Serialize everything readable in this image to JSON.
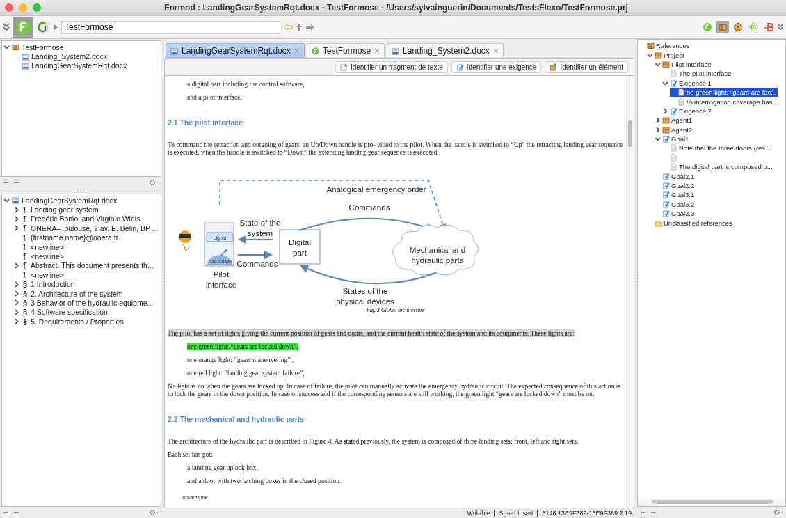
{
  "window": {
    "title": "Formod : LandingGearSystemRqt.docx - TestFormose - /Users/sylvainguerin/Documents/TestsFlexo/TestFormose.prj"
  },
  "toolbar": {
    "path_field": {
      "value": "TestFormose"
    }
  },
  "project_tree": [
    {
      "label": "TestFormose",
      "kind": "project",
      "expanded": true,
      "children": [
        {
          "label": "Landing_System2.docx",
          "kind": "docx"
        },
        {
          "label": "LandingGearSystemRqt.docx",
          "kind": "docx"
        }
      ]
    }
  ],
  "outline_tree": [
    {
      "label": "LandingGearSystemRqt.docx",
      "kind": "docx",
      "expanded": true,
      "children": [
        {
          "mark": "¶",
          "label": "Landing gear system",
          "kind": "paragraph",
          "expanded": false
        },
        {
          "mark": "¶",
          "label": "Frédéric Boniol and Virginie Wiels",
          "kind": "paragraph",
          "expanded": false
        },
        {
          "mark": "¶",
          "label": "ONERA–Toulouse, 2 av. E. Belin, BP ...",
          "kind": "paragraph",
          "expanded": false
        },
        {
          "mark": "¶",
          "label": "{firstname.name}@onera.fr",
          "kind": "paragraph"
        },
        {
          "mark": "¶",
          "label": "<newline>",
          "kind": "paragraph"
        },
        {
          "mark": "¶",
          "label": "<newline>",
          "kind": "paragraph"
        },
        {
          "mark": "¶",
          "label": "Abstract. This document presents th...",
          "kind": "paragraph",
          "expanded": false
        },
        {
          "mark": "¶",
          "label": "<newline>",
          "kind": "paragraph"
        },
        {
          "mark": "§",
          "label": "1 Introduction",
          "kind": "section",
          "expanded": false
        },
        {
          "mark": "§",
          "label": "2. Architecture of the system",
          "kind": "section",
          "expanded": false
        },
        {
          "mark": "§",
          "label": "3 Behavior of the hydraulic equipme...",
          "kind": "section",
          "expanded": false
        },
        {
          "mark": "§",
          "label": "4 Software specification",
          "kind": "section",
          "expanded": false
        },
        {
          "mark": "§",
          "label": "5. Requirements / Properties",
          "kind": "section",
          "expanded": false
        }
      ]
    }
  ],
  "tabs": [
    {
      "label": "LandingGearSystemRqt.docx",
      "kind": "docx",
      "selected": true
    },
    {
      "label": "TestFormose",
      "kind": "project-logo",
      "selected": false
    },
    {
      "label": "Landing_System2.docx",
      "kind": "docx",
      "selected": false
    }
  ],
  "action_buttons": [
    {
      "label": "Identifier un fragment de texte",
      "kind": "text"
    },
    {
      "label": "Identifier une exigence",
      "kind": "requirement"
    },
    {
      "label": "Identifier un élément",
      "kind": "element"
    }
  ],
  "document": [
    {
      "kind": "indent",
      "text": "a digital part including the control software,"
    },
    {
      "kind": "indent",
      "text": "and a pilot interface."
    },
    {
      "kind": "heading",
      "text": "2.1 The pilot interface"
    },
    {
      "kind": "para",
      "text": "To command the retraction and outgoing of gears, an Up/Down handle is pro- vided to the pilot. When the handle is switched to “Up” the retracting landing gear sequence is executed, when the handle is switched to “Down” the extending landing gear sequence is executed."
    },
    {
      "kind": "figure",
      "labels": {
        "emergency": [
          "Analogical emergency order"
        ],
        "commands_top": [
          "Commands"
        ],
        "state_system": [
          "State of the",
          "system"
        ],
        "lights": [
          "Lights"
        ],
        "up": [
          "Up"
        ],
        "down": [
          "Down"
        ],
        "commands_left": [
          "Commands"
        ],
        "digital": [
          "Digital",
          "part"
        ],
        "mechanical": [
          "Mechanical and",
          "hydraulic parts"
        ],
        "pilot": [
          "Pilot",
          "interface"
        ],
        "states_devices": [
          "States of the",
          "physical devices"
        ]
      },
      "caption": "**Fig. 3** Global architecture"
    },
    {
      "kind": "selection",
      "text": "The pilot has a set of lights giving the current position of gears and doors, and the current health state of the system and its equipments. These lights are:"
    },
    {
      "kind": "match",
      "text": "one green light: “gears are locked down”,"
    },
    {
      "kind": "indent",
      "text": "one orange light: “gears maneuvering” ,"
    },
    {
      "kind": "indent",
      "text": "one red light: “landing gear system failure”,"
    },
    {
      "kind": "para",
      "text": "No light is on when the gears are locked up. In case of failure, the pilot can manually activate the emergency hydraulic circuit. The expected consequence of this action is to lock the gears in the down position. In case of success and if the corresponding sensors are still working, the green light “gears are locked down” must be on."
    },
    {
      "kind": "heading",
      "text": "2.2 The mechanical and hydraulic parts"
    },
    {
      "kind": "para",
      "text": "The architecture of the hydraulic part is described in Figure 4. As stated previously, the system is composed of three landing sets: front, left and right sets."
    },
    {
      "kind": "para",
      "text": "Each set has got:"
    },
    {
      "kind": "indent",
      "text": "a landing gear uplock box,"
    },
    {
      "kind": "indent",
      "text": "and a door with two latching boxes in the closed position."
    },
    {
      "kind": "small",
      "text": "Towards the"
    }
  ],
  "status_bar": [
    "Writable",
    "Smart Insert",
    "3148  13E9F389-13E9F389:2:19"
  ],
  "references": [
    {
      "label": "References",
      "kind": "references",
      "selected": false,
      "children": [
        {
          "label": "Project",
          "kind": "package",
          "expanded": true,
          "selected": false,
          "children": [
            {
              "label": "Pilot interface",
              "kind": "package",
              "expanded": true,
              "selected": false,
              "children": [
                {
                  "label": "The pilot interface",
                  "kind": "page",
                  "selected": false
                },
                {
                  "label": "Exigence 1",
                  "kind": "requirement",
                  "expanded": true,
                  "selected": false,
                  "children": [
                    {
                      "label": "ne green light: \"gears are loc...",
                      "kind": "page",
                      "selected": true
                    },
                    {
                      "label": "/A interrogation coverage has ...",
                      "kind": "page",
                      "selected": false
                    }
                  ]
                },
                {
                  "label": "Exigence 2",
                  "kind": "requirement",
                  "expanded": false,
                  "selected": false
                }
              ]
            },
            {
              "label": "Agent1",
              "kind": "package",
              "expanded": false,
              "selected": false
            },
            {
              "label": "Agent2",
              "kind": "package",
              "expanded": false,
              "selected": false
            },
            {
              "label": "Goal1",
              "kind": "requirement",
              "expanded": true,
              "selected": false,
              "children": [
                {
                  "label": "Note that the three doors (res...",
                  "kind": "page",
                  "selected": false
                },
                {
                  "kind": "page",
                  "selected": false
                },
                {
                  "label": "The digital part is composed o...",
                  "kind": "page",
                  "selected": false
                }
              ]
            },
            {
              "label": "Goal2.1",
              "kind": "requirement",
              "selected": false
            },
            {
              "label": "Goal2.2",
              "kind": "requirement",
              "selected": false
            },
            {
              "label": "Goal3.1",
              "kind": "requirement",
              "selected": false
            },
            {
              "label": "Goal3.2",
              "kind": "requirement",
              "selected": false
            },
            {
              "label": "Goal3.3",
              "kind": "requirement",
              "selected": false
            }
          ]
        },
        {
          "label": "Unclassified references",
          "kind": "folder",
          "selected": false
        }
      ]
    }
  ]
}
